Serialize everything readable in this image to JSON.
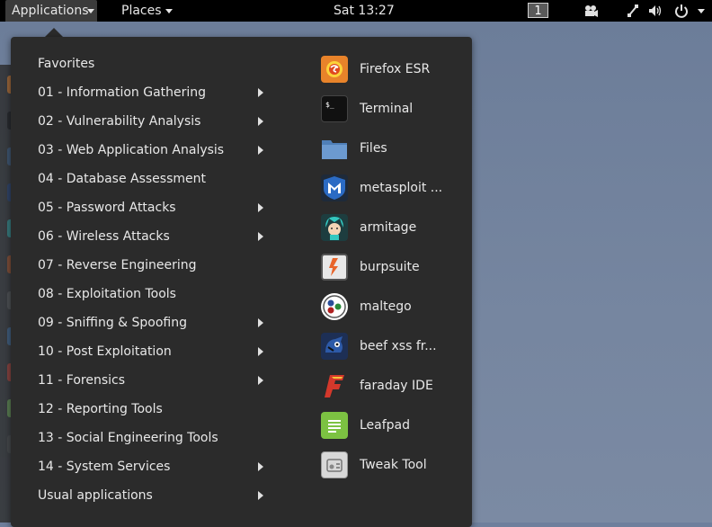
{
  "topbar": {
    "applications_label": "Applications",
    "places_label": "Places",
    "clock": "Sat 13:27",
    "workspace": "1"
  },
  "menu": {
    "categories": [
      {
        "label": "Favorites",
        "submenu": false
      },
      {
        "label": "01 - Information Gathering",
        "submenu": true
      },
      {
        "label": "02 - Vulnerability Analysis",
        "submenu": true
      },
      {
        "label": "03 - Web Application Analysis",
        "submenu": true
      },
      {
        "label": "04 - Database Assessment",
        "submenu": false
      },
      {
        "label": "05 - Password Attacks",
        "submenu": true
      },
      {
        "label": "06 - Wireless Attacks",
        "submenu": true
      },
      {
        "label": "07 - Reverse Engineering",
        "submenu": false
      },
      {
        "label": "08 - Exploitation Tools",
        "submenu": false
      },
      {
        "label": "09 - Sniffing & Spoofing",
        "submenu": true
      },
      {
        "label": "10 - Post Exploitation",
        "submenu": true
      },
      {
        "label": "11 - Forensics",
        "submenu": true
      },
      {
        "label": "12 - Reporting Tools",
        "submenu": false
      },
      {
        "label": "13 - Social Engineering Tools",
        "submenu": false
      },
      {
        "label": "14 - System Services",
        "submenu": true
      },
      {
        "label": "Usual applications",
        "submenu": true
      }
    ],
    "apps": [
      {
        "label": "Firefox ESR",
        "icon": "firefox-icon"
      },
      {
        "label": "Terminal",
        "icon": "terminal-icon"
      },
      {
        "label": "Files",
        "icon": "files-icon"
      },
      {
        "label": "metasploit ...",
        "icon": "metasploit-icon"
      },
      {
        "label": "armitage",
        "icon": "armitage-icon"
      },
      {
        "label": "burpsuite",
        "icon": "burpsuite-icon"
      },
      {
        "label": "maltego",
        "icon": "maltego-icon"
      },
      {
        "label": "beef xss fr...",
        "icon": "beef-icon"
      },
      {
        "label": "faraday IDE",
        "icon": "faraday-icon"
      },
      {
        "label": "Leafpad",
        "icon": "leafpad-icon"
      },
      {
        "label": "Tweak Tool",
        "icon": "tweak-tool-icon"
      }
    ]
  },
  "colors": {
    "topbar_bg": "#000000",
    "menu_bg": "#2b2b2b",
    "desktop_bg": "#6e7f9c"
  }
}
